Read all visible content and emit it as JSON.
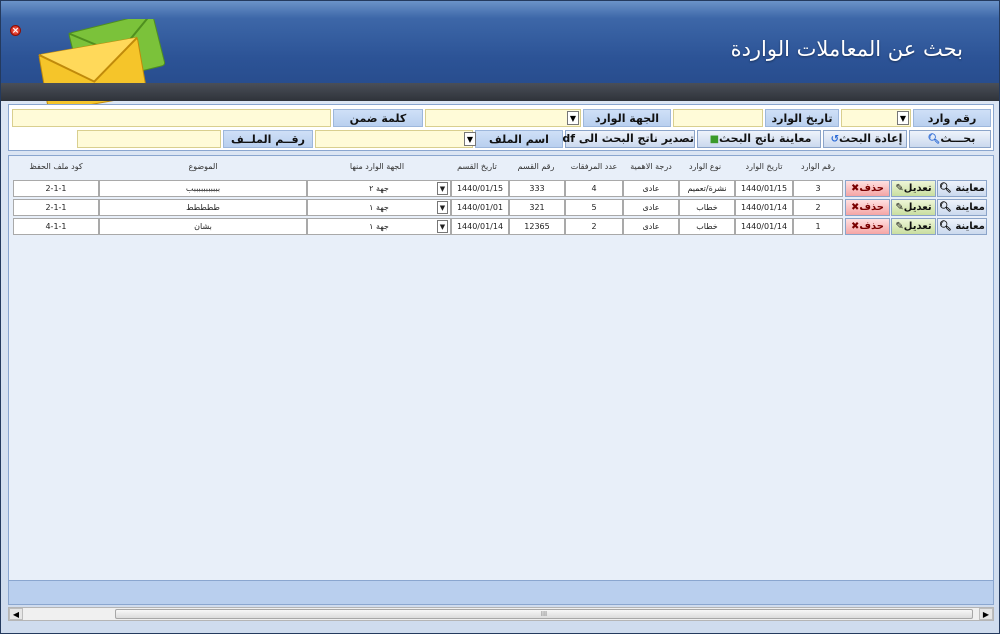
{
  "window": {
    "title": "بحث عن المعاملات الواردة"
  },
  "search": {
    "label_incoming_no": "رقم وارد",
    "label_incoming_date": "تاريخ الوارد",
    "label_from_entity": "الجهة الوارد منها",
    "label_keyword": "كلمة ضمن الموضوع",
    "label_file_name": "اسم الملف",
    "label_file_no": "رقــم الملــف",
    "btn_search": "بحـــث",
    "btn_reset": "إعادة البحث",
    "btn_preview": "معاينة ناتج البحث",
    "btn_export": "تصدير ناتج البحث الى pdf"
  },
  "columns": {
    "incoming_no": "رقم الوارد",
    "incoming_date": "تاريخ الوارد",
    "type": "نوع الوارد",
    "importance": "درجة الاهمية",
    "attachments": "عدد المرفقات",
    "dept_no": "رقم القسم",
    "dept_date": "تاريخ القسم",
    "from_entity": "الجهة الوارد منها",
    "subject": "الموضوع",
    "file_code": "كود ملف الحفظ"
  },
  "row_buttons": {
    "view": "معاينة",
    "edit": "تعديل",
    "delete": "حذف"
  },
  "rows": [
    {
      "incoming_no": "3",
      "incoming_date": "1440/01/15",
      "type": "نشرة/تعميم",
      "importance": "عادى",
      "attachments": "4",
      "dept_no": "333",
      "dept_date": "1440/01/15",
      "from_entity": "جهة ٢",
      "subject": "بببببببببببب",
      "file_code": "2-1-1"
    },
    {
      "incoming_no": "2",
      "incoming_date": "1440/01/14",
      "type": "خطاب",
      "importance": "عادى",
      "attachments": "5",
      "dept_no": "321",
      "dept_date": "1440/01/01",
      "from_entity": "جهة ١",
      "subject": "ططططط",
      "file_code": "2-1-1"
    },
    {
      "incoming_no": "1",
      "incoming_date": "1440/01/14",
      "type": "خطاب",
      "importance": "عادى",
      "attachments": "2",
      "dept_no": "12365",
      "dept_date": "1440/01/14",
      "from_entity": "جهة ١",
      "subject": "بشان",
      "file_code": "4-1-1"
    }
  ],
  "scroll": {
    "thumb_grip": "III"
  },
  "colors": {
    "header_blue": "#2c5396",
    "input_yellow": "#fffbd8",
    "delete_red": "#f5a5a5",
    "edit_green": "#c9dea0"
  }
}
